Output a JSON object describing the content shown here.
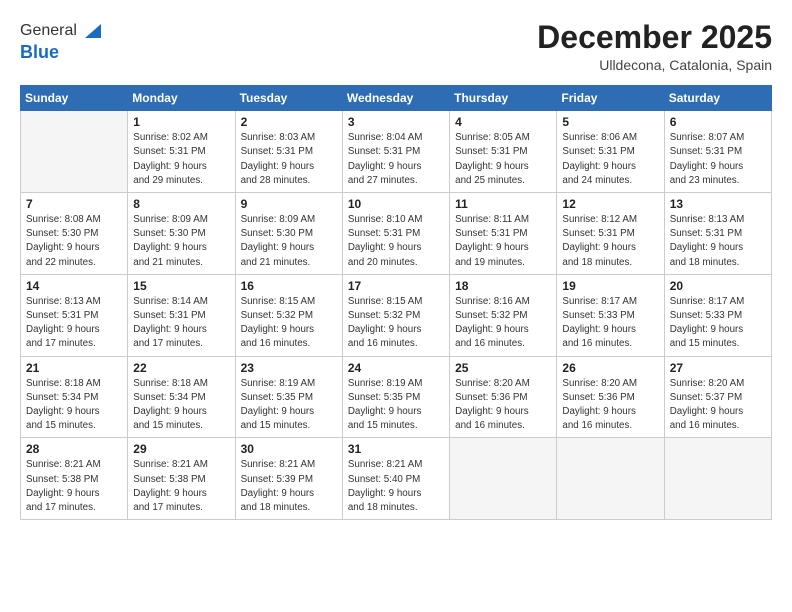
{
  "logo": {
    "general": "General",
    "blue": "Blue"
  },
  "header": {
    "month": "December 2025",
    "location": "Ulldecona, Catalonia, Spain"
  },
  "weekdays": [
    "Sunday",
    "Monday",
    "Tuesday",
    "Wednesday",
    "Thursday",
    "Friday",
    "Saturday"
  ],
  "weeks": [
    [
      {
        "day": "",
        "info": ""
      },
      {
        "day": "1",
        "info": "Sunrise: 8:02 AM\nSunset: 5:31 PM\nDaylight: 9 hours\nand 29 minutes."
      },
      {
        "day": "2",
        "info": "Sunrise: 8:03 AM\nSunset: 5:31 PM\nDaylight: 9 hours\nand 28 minutes."
      },
      {
        "day": "3",
        "info": "Sunrise: 8:04 AM\nSunset: 5:31 PM\nDaylight: 9 hours\nand 27 minutes."
      },
      {
        "day": "4",
        "info": "Sunrise: 8:05 AM\nSunset: 5:31 PM\nDaylight: 9 hours\nand 25 minutes."
      },
      {
        "day": "5",
        "info": "Sunrise: 8:06 AM\nSunset: 5:31 PM\nDaylight: 9 hours\nand 24 minutes."
      },
      {
        "day": "6",
        "info": "Sunrise: 8:07 AM\nSunset: 5:31 PM\nDaylight: 9 hours\nand 23 minutes."
      }
    ],
    [
      {
        "day": "7",
        "info": "Sunrise: 8:08 AM\nSunset: 5:30 PM\nDaylight: 9 hours\nand 22 minutes."
      },
      {
        "day": "8",
        "info": "Sunrise: 8:09 AM\nSunset: 5:30 PM\nDaylight: 9 hours\nand 21 minutes."
      },
      {
        "day": "9",
        "info": "Sunrise: 8:09 AM\nSunset: 5:30 PM\nDaylight: 9 hours\nand 21 minutes."
      },
      {
        "day": "10",
        "info": "Sunrise: 8:10 AM\nSunset: 5:31 PM\nDaylight: 9 hours\nand 20 minutes."
      },
      {
        "day": "11",
        "info": "Sunrise: 8:11 AM\nSunset: 5:31 PM\nDaylight: 9 hours\nand 19 minutes."
      },
      {
        "day": "12",
        "info": "Sunrise: 8:12 AM\nSunset: 5:31 PM\nDaylight: 9 hours\nand 18 minutes."
      },
      {
        "day": "13",
        "info": "Sunrise: 8:13 AM\nSunset: 5:31 PM\nDaylight: 9 hours\nand 18 minutes."
      }
    ],
    [
      {
        "day": "14",
        "info": "Sunrise: 8:13 AM\nSunset: 5:31 PM\nDaylight: 9 hours\nand 17 minutes."
      },
      {
        "day": "15",
        "info": "Sunrise: 8:14 AM\nSunset: 5:31 PM\nDaylight: 9 hours\nand 17 minutes."
      },
      {
        "day": "16",
        "info": "Sunrise: 8:15 AM\nSunset: 5:32 PM\nDaylight: 9 hours\nand 16 minutes."
      },
      {
        "day": "17",
        "info": "Sunrise: 8:15 AM\nSunset: 5:32 PM\nDaylight: 9 hours\nand 16 minutes."
      },
      {
        "day": "18",
        "info": "Sunrise: 8:16 AM\nSunset: 5:32 PM\nDaylight: 9 hours\nand 16 minutes."
      },
      {
        "day": "19",
        "info": "Sunrise: 8:17 AM\nSunset: 5:33 PM\nDaylight: 9 hours\nand 16 minutes."
      },
      {
        "day": "20",
        "info": "Sunrise: 8:17 AM\nSunset: 5:33 PM\nDaylight: 9 hours\nand 15 minutes."
      }
    ],
    [
      {
        "day": "21",
        "info": "Sunrise: 8:18 AM\nSunset: 5:34 PM\nDaylight: 9 hours\nand 15 minutes."
      },
      {
        "day": "22",
        "info": "Sunrise: 8:18 AM\nSunset: 5:34 PM\nDaylight: 9 hours\nand 15 minutes."
      },
      {
        "day": "23",
        "info": "Sunrise: 8:19 AM\nSunset: 5:35 PM\nDaylight: 9 hours\nand 15 minutes."
      },
      {
        "day": "24",
        "info": "Sunrise: 8:19 AM\nSunset: 5:35 PM\nDaylight: 9 hours\nand 15 minutes."
      },
      {
        "day": "25",
        "info": "Sunrise: 8:20 AM\nSunset: 5:36 PM\nDaylight: 9 hours\nand 16 minutes."
      },
      {
        "day": "26",
        "info": "Sunrise: 8:20 AM\nSunset: 5:36 PM\nDaylight: 9 hours\nand 16 minutes."
      },
      {
        "day": "27",
        "info": "Sunrise: 8:20 AM\nSunset: 5:37 PM\nDaylight: 9 hours\nand 16 minutes."
      }
    ],
    [
      {
        "day": "28",
        "info": "Sunrise: 8:21 AM\nSunset: 5:38 PM\nDaylight: 9 hours\nand 17 minutes."
      },
      {
        "day": "29",
        "info": "Sunrise: 8:21 AM\nSunset: 5:38 PM\nDaylight: 9 hours\nand 17 minutes."
      },
      {
        "day": "30",
        "info": "Sunrise: 8:21 AM\nSunset: 5:39 PM\nDaylight: 9 hours\nand 18 minutes."
      },
      {
        "day": "31",
        "info": "Sunrise: 8:21 AM\nSunset: 5:40 PM\nDaylight: 9 hours\nand 18 minutes."
      },
      {
        "day": "",
        "info": ""
      },
      {
        "day": "",
        "info": ""
      },
      {
        "day": "",
        "info": ""
      }
    ]
  ]
}
